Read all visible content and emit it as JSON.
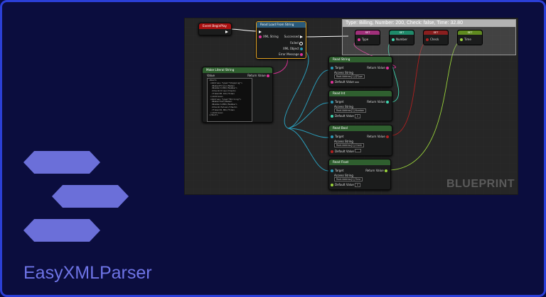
{
  "app_title": "EasyXMLParser",
  "colors": {
    "background": "#0b0d3e",
    "frame_border": "#2b3fd6",
    "hexagons": "#6b6fd9",
    "title_text": "#6e74e6"
  },
  "blueprint": {
    "watermark": "BLUEPRINT",
    "comment_title": "Type: Billing, Number: 200, Check: false, Time: 32.80",
    "event_node": {
      "title": "Event BeginPlay"
    },
    "read_node": {
      "title": "Read Load From String",
      "in_pins": [
        "XML String"
      ],
      "out_pins": [
        "Successed",
        "Failed",
        "XML Object",
        "Error Message"
      ]
    },
    "string_node": {
      "title": "Make Literal String",
      "pin_in": "Value",
      "pin_out": "Return Value",
      "xml_text": "<Root>\n <Address Type=\"Shipping\">\n  <Name>Ellen</Name>\n  <Number>100</Number>\n  <Check>true</Check>\n  <Time>30.10</Time>\n </Address>\n <Address Type=\"Billing\">\n  <Name>Tom</Name>\n  <Number>200</Number>\n  <Check>false</Check>\n  <Time>32.80</Time>\n </Address>\n</Root>"
    },
    "set_nodes": [
      {
        "title": "SET",
        "pin": "Type"
      },
      {
        "title": "SET",
        "pin": "Number"
      },
      {
        "title": "SET",
        "pin": "Check"
      },
      {
        "title": "SET",
        "pin": "Time"
      }
    ],
    "read_nodes": [
      {
        "title": "Read String",
        "access": "Root.Address[1].@Type",
        "default": ""
      },
      {
        "title": "Read Int",
        "access": "Root.Address[1].Number",
        "default": "0"
      },
      {
        "title": "Read Bool",
        "access": "Root.Address[1].Check",
        "default": ""
      },
      {
        "title": "Read Float",
        "access": "Root.Address[1].Time",
        "default": "0"
      }
    ],
    "labels": {
      "target": "Target",
      "access_string": "Access String",
      "default_value": "Default Value",
      "return_value": "Return Value"
    }
  }
}
